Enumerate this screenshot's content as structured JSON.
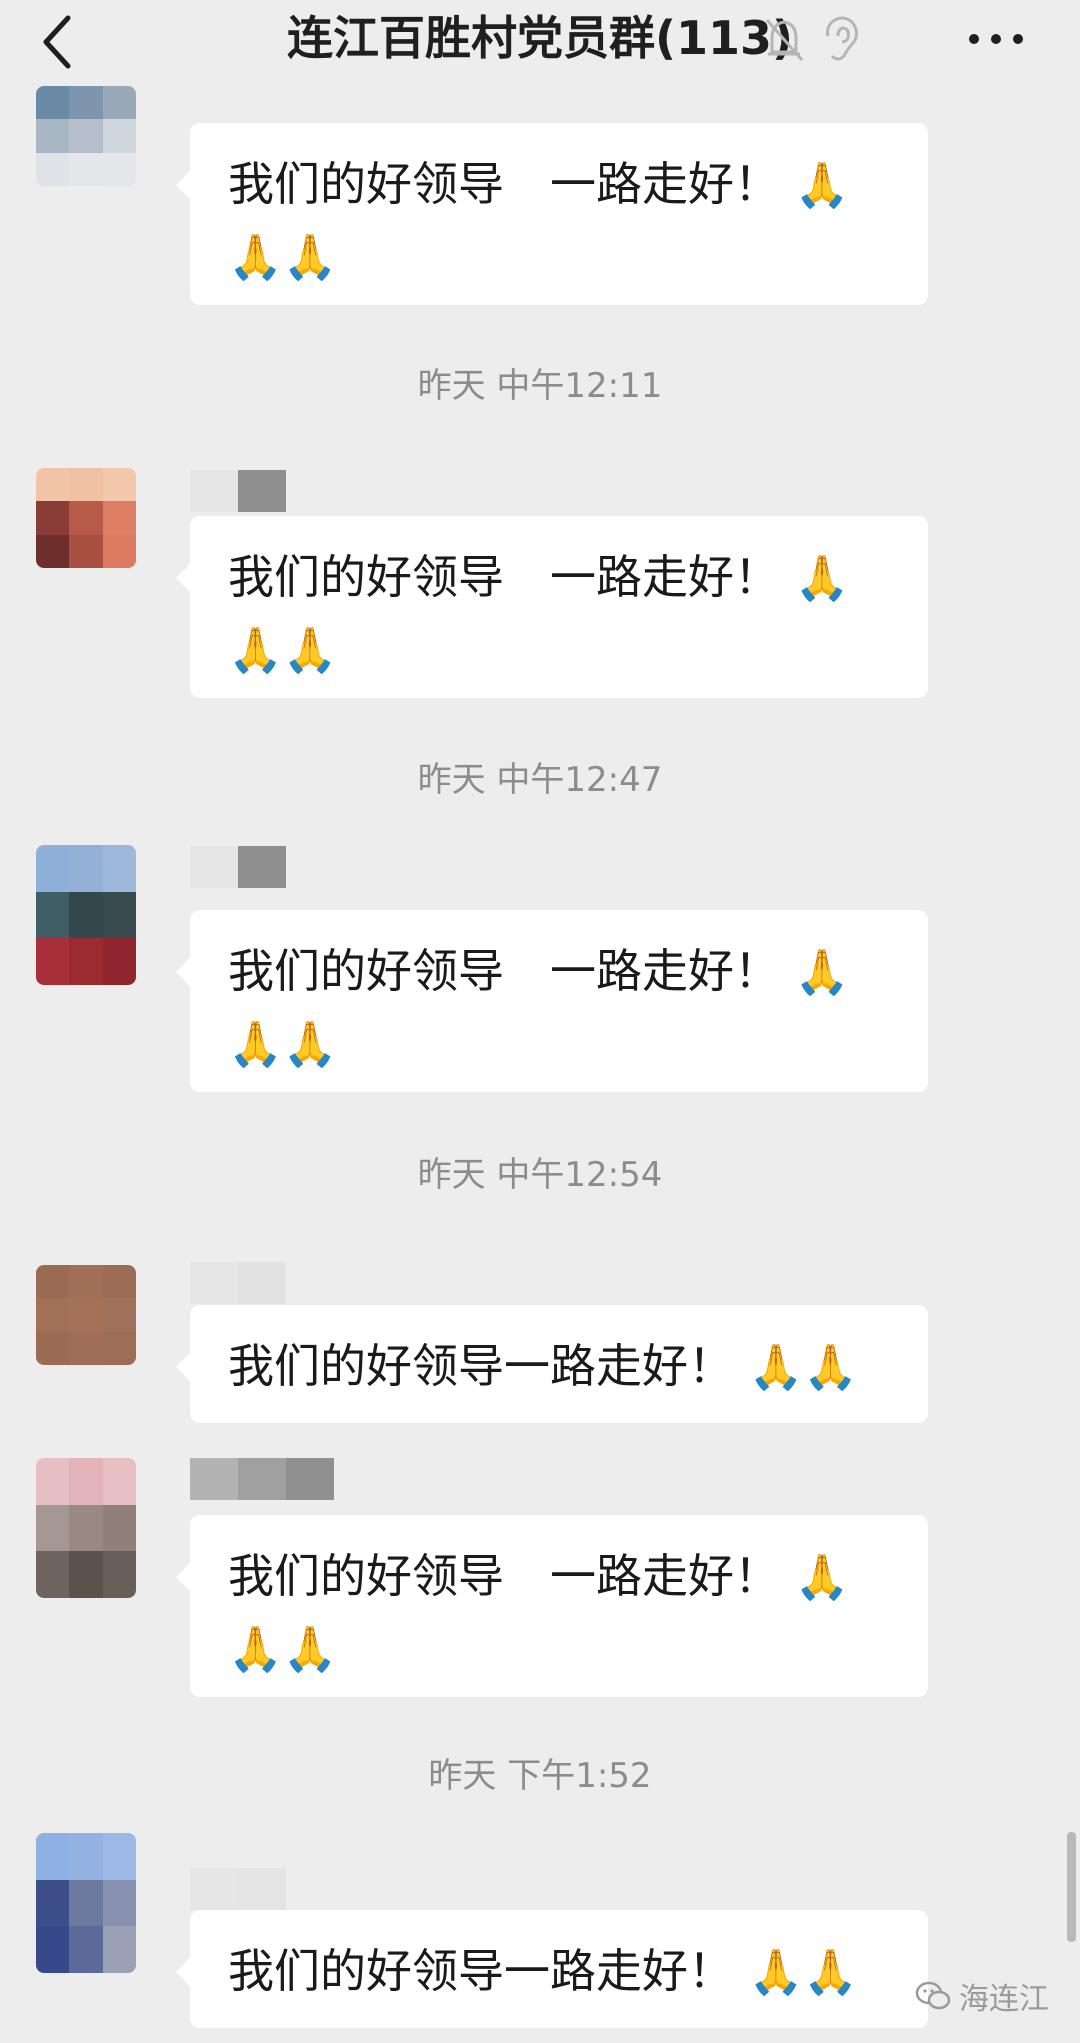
{
  "header": {
    "title": "连江百胜村党员群(113)",
    "back_icon": "chevron-left-icon",
    "mute_icon": "bell-off-icon",
    "ear_icon": "ear-icon",
    "more_icon": "more-dots-icon"
  },
  "messages": [
    {
      "part1": "我们的好领导",
      "part2": "一路走好！",
      "emoji_end": "🙏",
      "emoji_line2": "🙏🙏"
    },
    {
      "part1": "我们的好领导",
      "part2": "一路走好！",
      "emoji_end": "🙏",
      "emoji_line2": "🙏🙏"
    },
    {
      "part1": "我们的好领导",
      "part2": "一路走好！",
      "emoji_end": "🙏",
      "emoji_line2": "🙏🙏"
    },
    {
      "text": "我们的好领导一路走好！",
      "emoji": "🙏🙏"
    },
    {
      "part1": "我们的好领导",
      "part2": "一路走好！",
      "emoji_end": "🙏",
      "emoji_line2": "🙏🙏"
    },
    {
      "text": "我们的好领导一路走好！",
      "emoji": "🙏🙏"
    }
  ],
  "timestamps": [
    "昨天 中午12:11",
    "昨天 中午12:47",
    "昨天 中午12:54",
    "昨天 下午1:52"
  ],
  "watermark": {
    "text": "海连江",
    "icon": "wechat-icon"
  }
}
